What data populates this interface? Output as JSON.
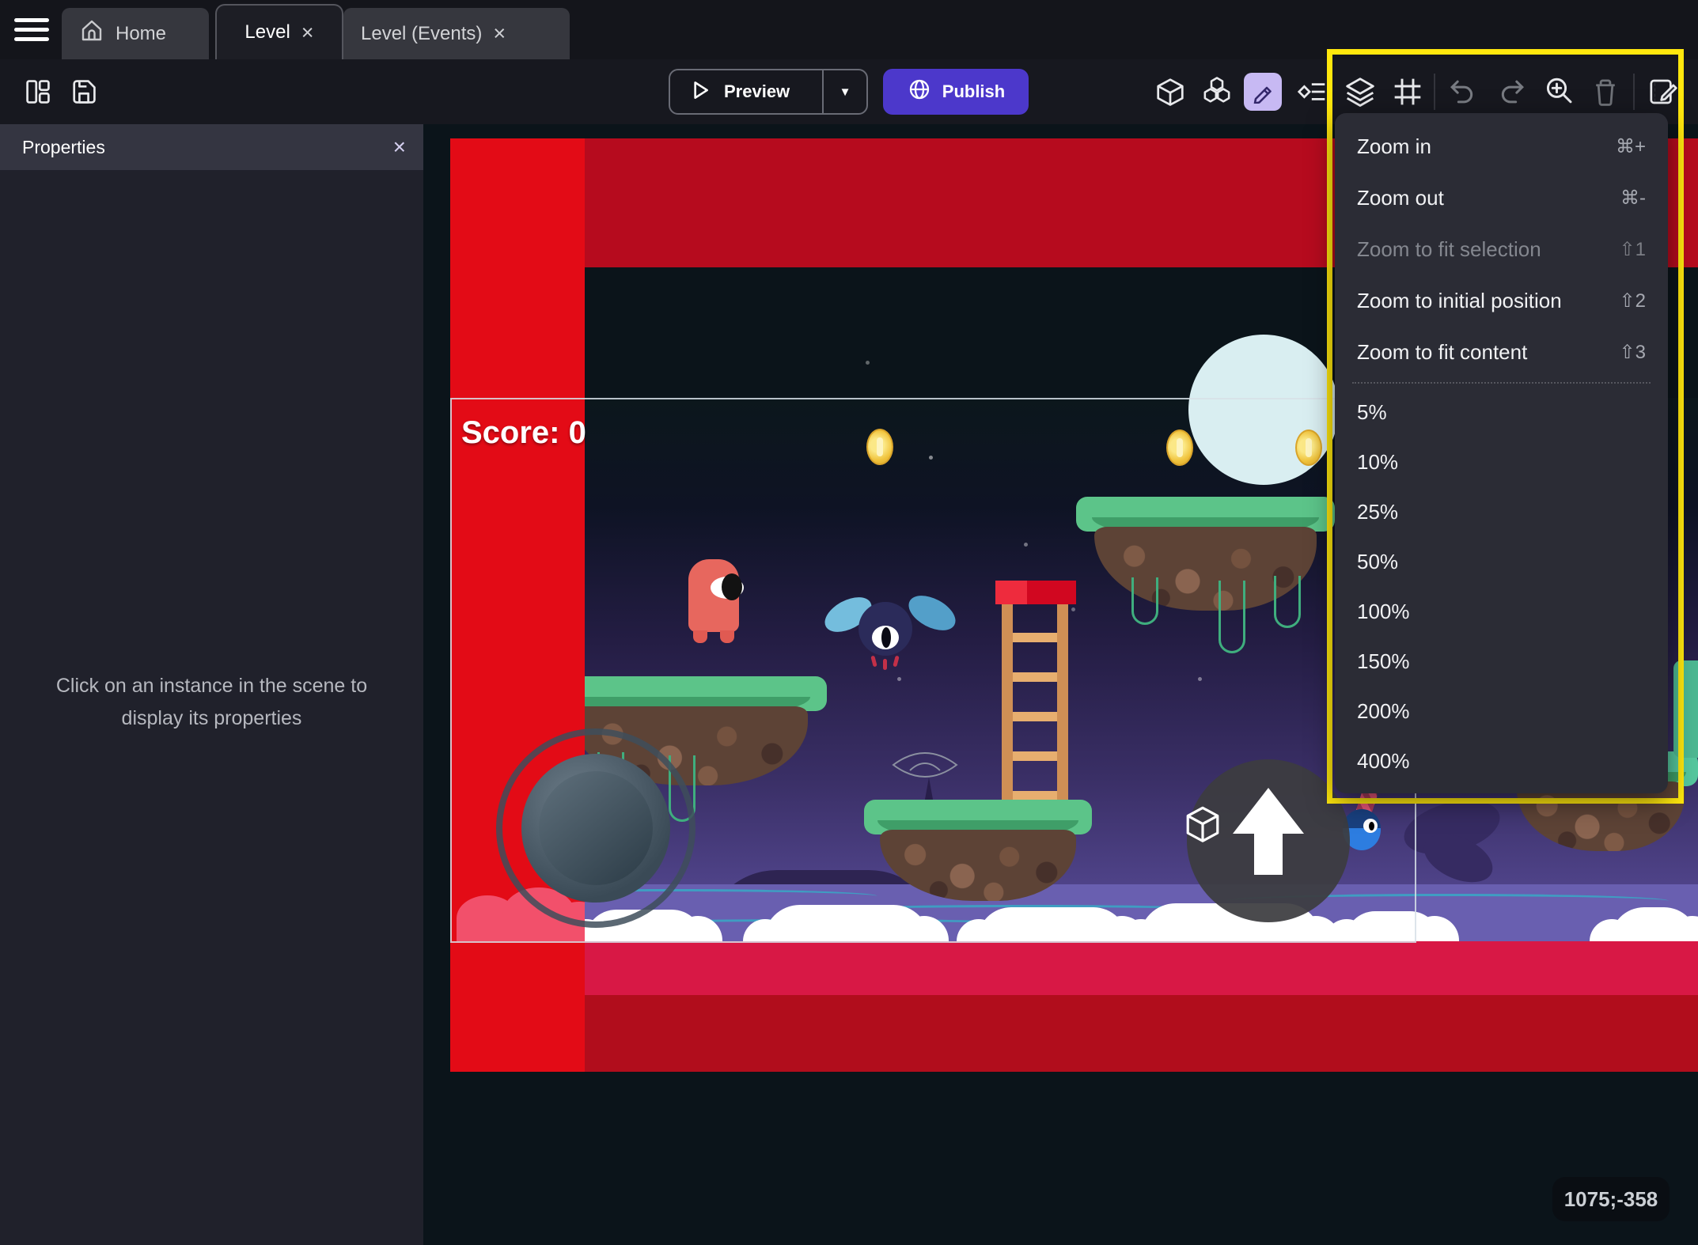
{
  "tabs": [
    {
      "label": "Home"
    },
    {
      "label": "Level"
    },
    {
      "label": "Level (Events)"
    }
  ],
  "glyphs": {
    "close": "×",
    "caret_down": "▼"
  },
  "toolbar": {
    "preview_label": "Preview",
    "publish_label": "Publish"
  },
  "properties_panel": {
    "title": "Properties",
    "empty_message": "Click on an instance in the scene to display its properties"
  },
  "scene": {
    "score_text": "Score: 0",
    "coordinates_badge": "1075;-358"
  },
  "zoom_menu": {
    "items": [
      {
        "label": "Zoom in",
        "shortcut": "⌘+"
      },
      {
        "label": "Zoom out",
        "shortcut": "⌘-"
      },
      {
        "label": "Zoom to fit selection",
        "shortcut": "⇧1",
        "disabled": true
      },
      {
        "label": "Zoom to initial position",
        "shortcut": "⇧2"
      },
      {
        "label": "Zoom to fit content",
        "shortcut": "⇧3"
      },
      {
        "label": "5%"
      },
      {
        "label": "10%"
      },
      {
        "label": "25%"
      },
      {
        "label": "50%"
      },
      {
        "label": "100%"
      },
      {
        "label": "150%"
      },
      {
        "label": "200%"
      },
      {
        "label": "400%"
      }
    ]
  },
  "colors": {
    "accent_purple": "#4c38cb",
    "edit_tool_bg": "#c7b9f3",
    "highlight_yellow": "#ffe70d",
    "band_red": "#b60b1e",
    "strip_red": "#e30b16",
    "crimson_band": "#d81845",
    "dark_red_band": "#b10d1c"
  }
}
